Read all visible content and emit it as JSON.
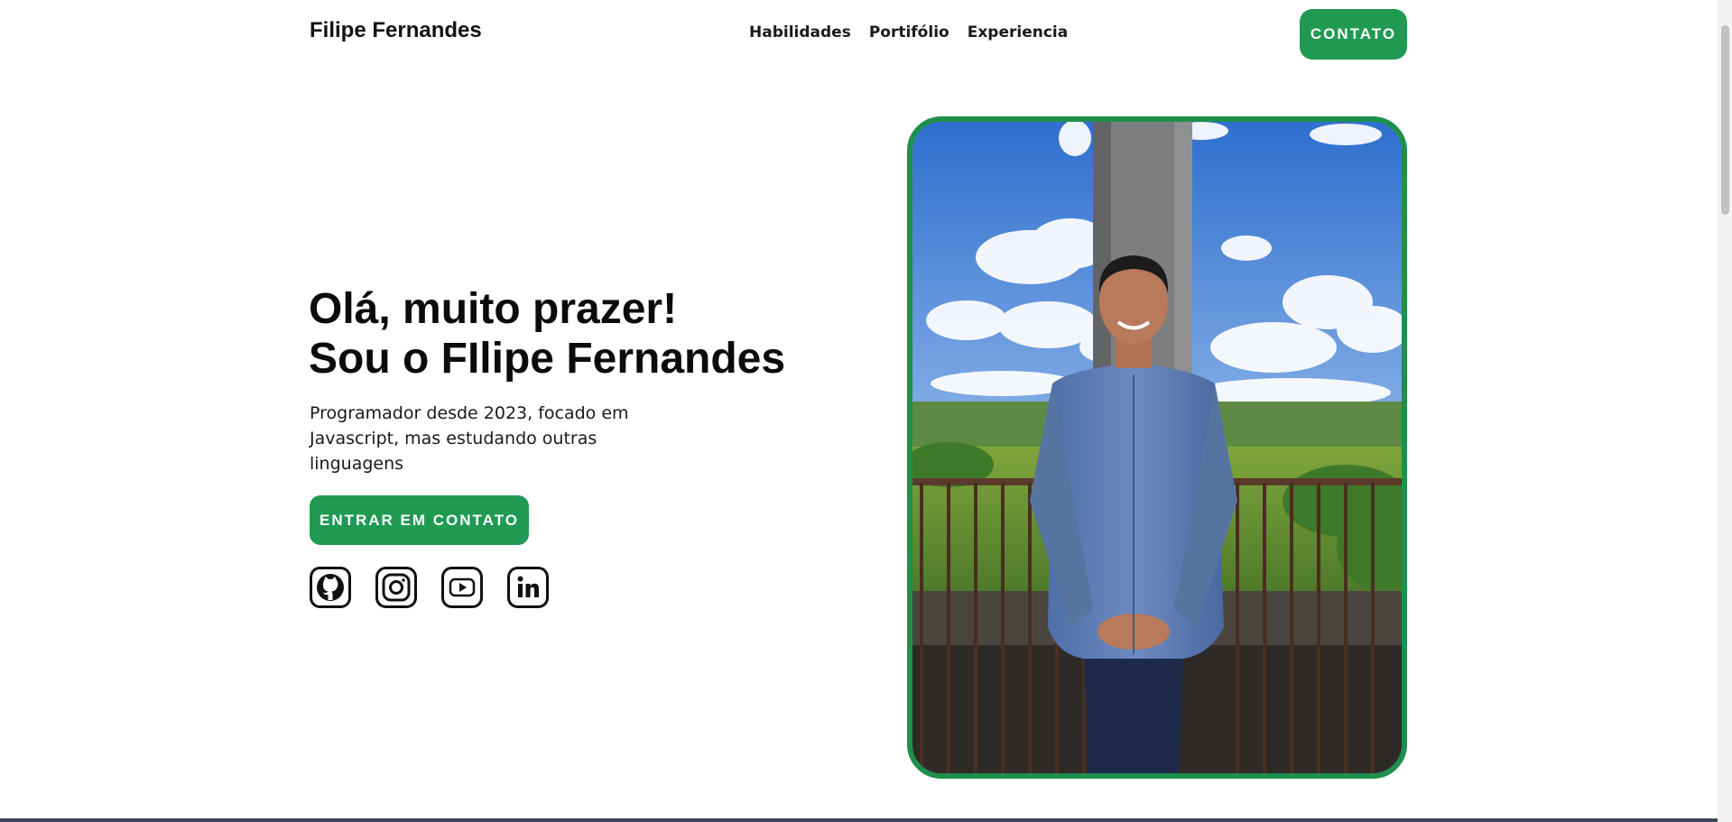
{
  "header": {
    "logo": "Filipe Fernandes",
    "nav": [
      "Habilidades",
      "Portifólio",
      "Experiencia"
    ],
    "contact_button": "CONTATO"
  },
  "hero": {
    "title_line1": "Olá, muito prazer!",
    "title_line2": "Sou o FIlipe Fernandes",
    "subtitle": "Programador desde 2023, focado em Javascript, mas estudando outras linguagens",
    "cta": "ENTRAR EM CONTATO",
    "socials": [
      "github-icon",
      "instagram-icon",
      "youtube-icon",
      "linkedin-icon"
    ]
  },
  "colors": {
    "accent": "#209a52",
    "frame": "#1e8f4c",
    "text": "#111111"
  }
}
